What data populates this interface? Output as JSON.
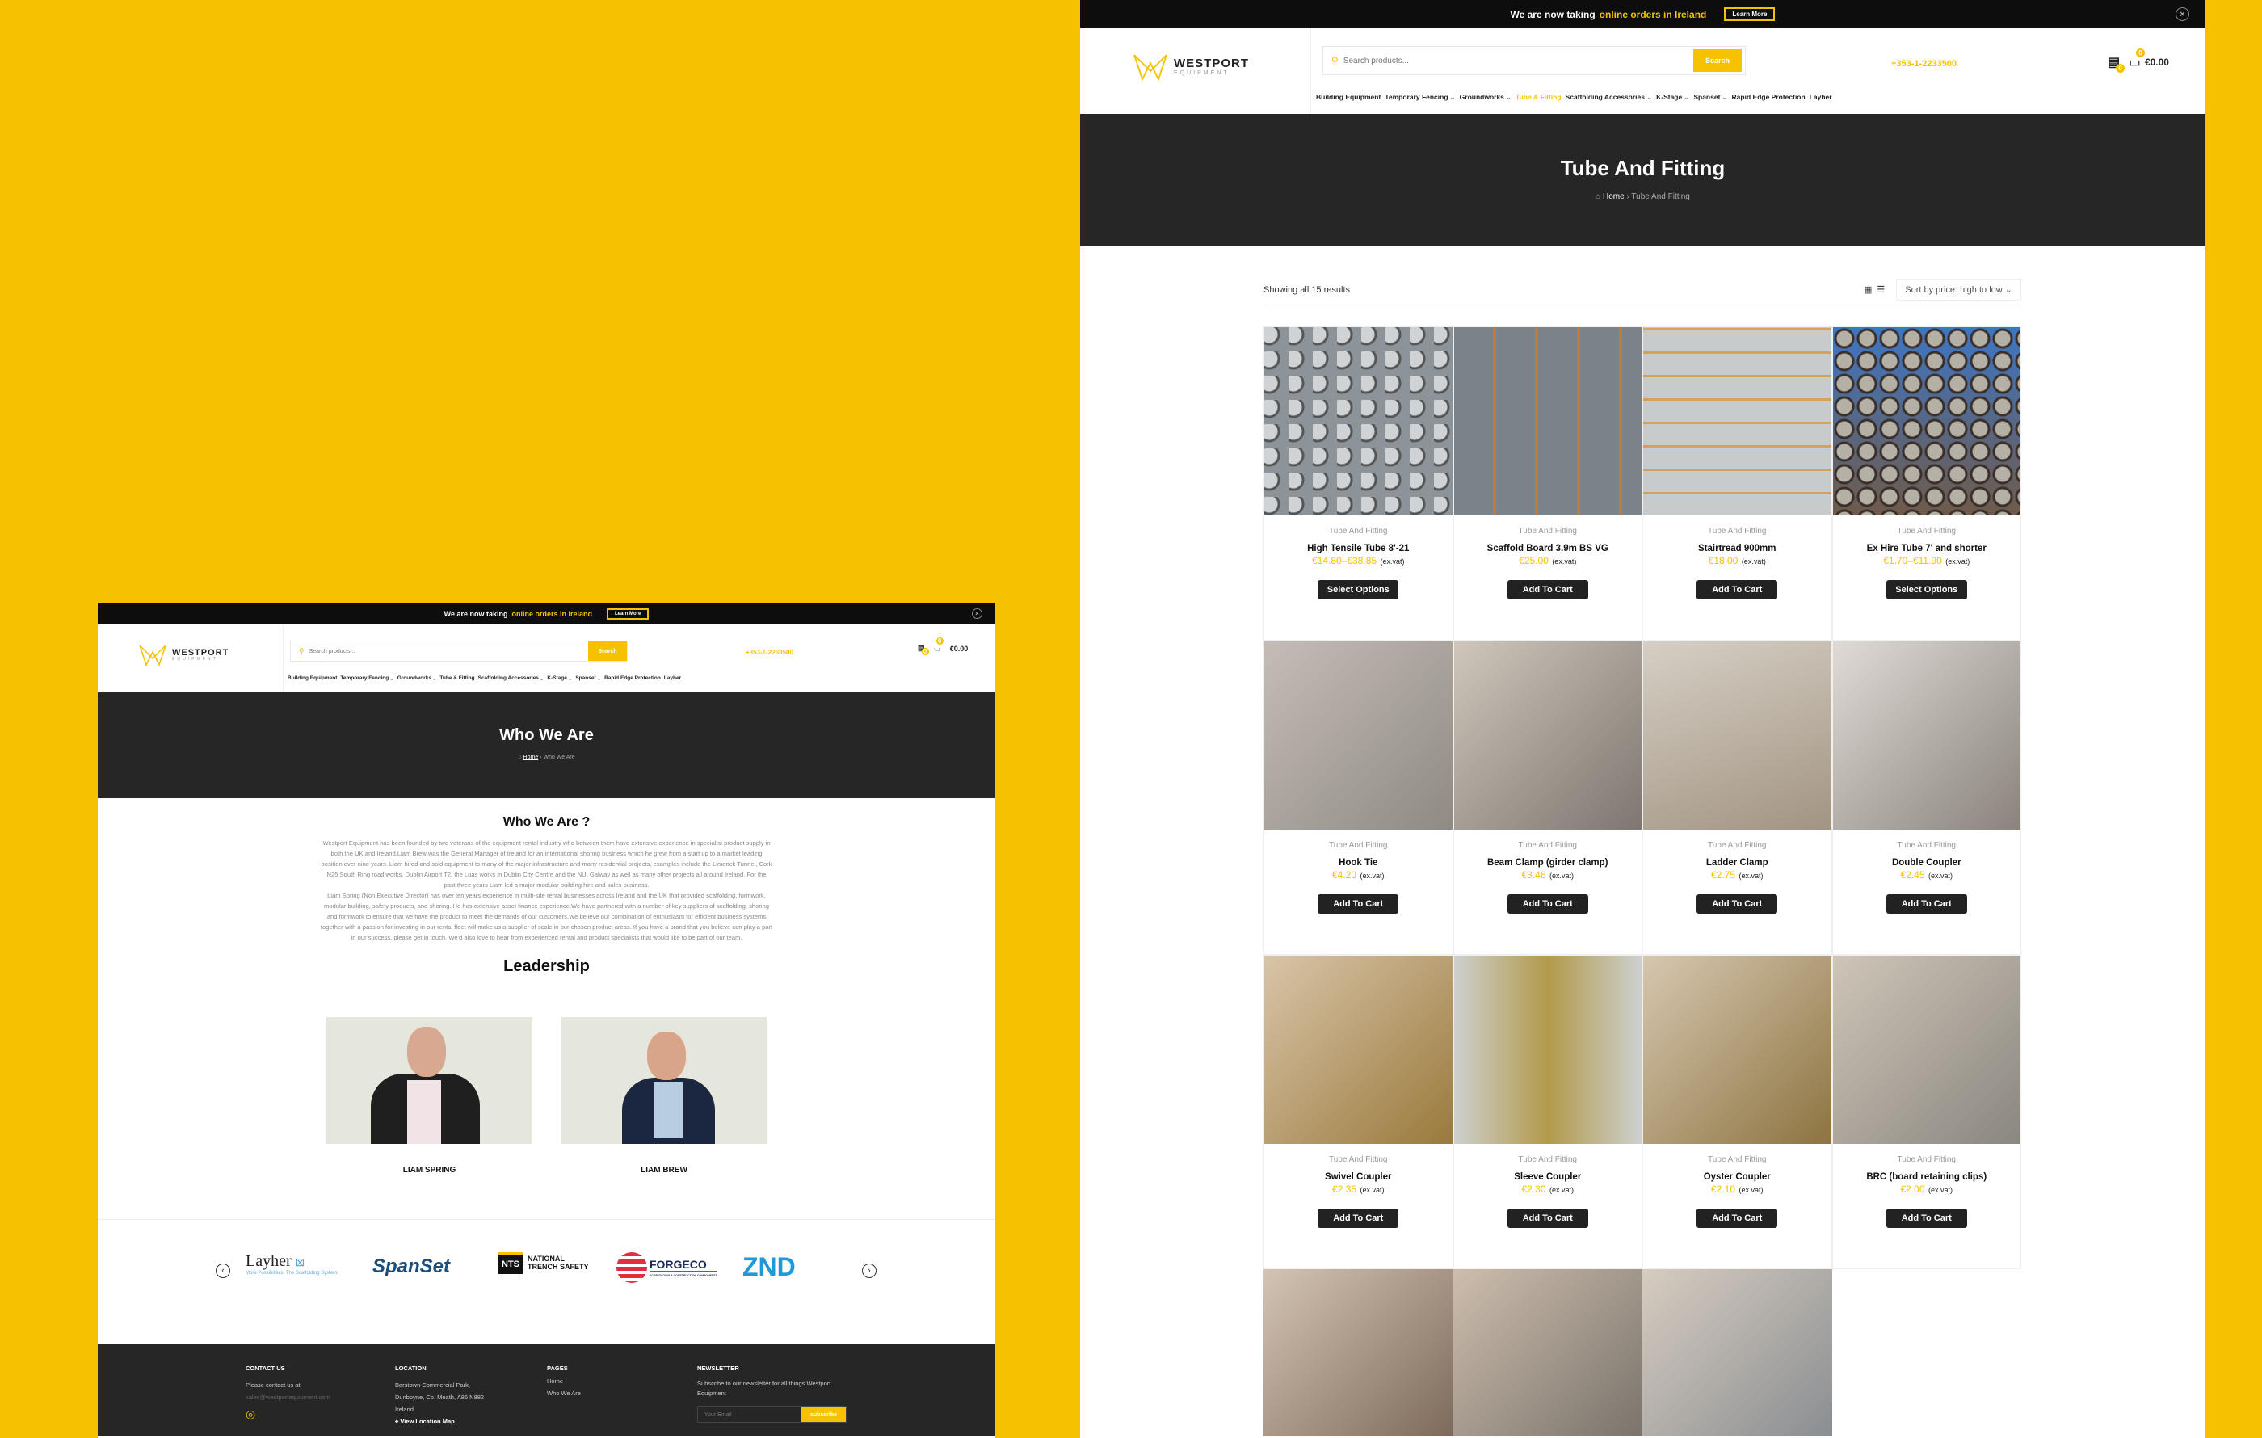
{
  "colors": {
    "brand_yellow": "#f6c200",
    "dark": "#262626",
    "topbar": "#0d0d0d"
  },
  "announcement": {
    "prefix": "We are now taking",
    "highlight": "online orders in Ireland",
    "learn_more": "Learn More",
    "close_icon": "close-circle-icon"
  },
  "brand": {
    "name": "WESTPORT",
    "sub": "EQUIPMENT"
  },
  "search": {
    "placeholder": "Search products...",
    "button": "Search"
  },
  "phone": "+353-1-2233500",
  "wishlist_count": "0",
  "cart": {
    "count": "0",
    "total": "€0.00"
  },
  "nav": [
    "Building Equipment",
    "Temporary Fencing",
    "Groundworks",
    "Tube & Fitting",
    "Scaffolding Accessories",
    "K-Stage",
    "Spanset",
    "Rapid Edge Protection",
    "Layher"
  ],
  "nav_dropdowns": [
    false,
    true,
    true,
    false,
    true,
    true,
    true,
    false,
    false
  ],
  "left_page": {
    "title": "Who We Are",
    "breadcrumb": {
      "home": "Home",
      "current": "Who We Are"
    },
    "section_title": "Who We Are ?",
    "paragraphs": [
      "Westport Equipment has been founded by two veterans of the equipment rental industry who between them have extensive experience in specialist product supply in both the UK and Ireland.Liam Brew was the General Manager of Ireland for an international shoring business which he grew from a start up to a market leading position over nine years. Liam hired and sold equipment to many of the major infrastructure and many residential projects, examples include the Limerick Tunnel, Cork N25 South Ring road works, Dublin Airport T2, the Luas works in Dublin City Centre and the NUI Galway as well as many other projects all around Ireland. For the past three years Liam led a major modular building hire and sales business.",
      "Liam Spring (Non Executive Director) has over ten years experience in multi-site rental businesses across Ireland and the UK that provided scaffolding, formwork, modular building, safety products, and shoring. He has extensive asset finance experience.We have partnered with a number of key suppliers of scaffolding, shoring and formwork to ensure that we have the product to meet the demands of our customers.We believe our combination of enthusiasm for efficient business systems together with a passion for investing in our rental fleet will make us a supplier of scale in our chosen product areas. If you have a brand that you believe can play a part in our success, please get in touch. We'd also love to hear from experienced rental and product specialists that would like to be part of our team."
    ],
    "leadership_title": "Leadership",
    "leaders": [
      {
        "name": "LIAM SPRING"
      },
      {
        "name": "LIAM BREW"
      }
    ],
    "partner_logos": [
      "Layher",
      "SpanSet",
      "NATIONAL TRENCH SAFETY",
      "FORGECO",
      "ZND"
    ],
    "partner_taglines": {
      "layher": "More Possibilities. The Scaffolding System.",
      "nts": "NTS",
      "forgeco": "SCAFFOLDING & CONSTRUCTION COMPONENTS"
    },
    "footer": {
      "contact": {
        "title": "CONTACT US",
        "text": "Please contact us at",
        "email": "sales@westportequipment.com"
      },
      "location": {
        "title": "LOCATION",
        "lines": [
          "Barstown Commercial Park,",
          "Dunboyne, Co. Meath, A86 N882",
          "Ireland."
        ],
        "map_link": "View Location Map"
      },
      "pages": {
        "title": "PAGES",
        "links": [
          "Home",
          "Who We Are"
        ]
      },
      "newsletter": {
        "title": "NEWSLETTER",
        "text": "Subscribe to our newsletter for all things Westport Equipment",
        "placeholder": "Your Email",
        "button": "subscribe"
      }
    }
  },
  "right_page": {
    "title": "Tube And Fitting",
    "breadcrumb": {
      "home": "Home",
      "current": "Tube And Fitting"
    },
    "results": "Showing all 15 results",
    "sort": "Sort by price: high to low",
    "ex_vat": "(ex.vat)",
    "products": [
      {
        "category": "Tube And Fitting",
        "name": "High Tensile Tube 8'-21",
        "price": "€14.80–€38.85",
        "button": "Select Options"
      },
      {
        "category": "Tube And Fitting",
        "name": "Scaffold Board 3.9m BS VG",
        "price": "€25.00",
        "button": "Add To Cart"
      },
      {
        "category": "Tube And Fitting",
        "name": "Stairtread 900mm",
        "price": "€18.00",
        "button": "Add To Cart"
      },
      {
        "category": "Tube And Fitting",
        "name": "Ex Hire Tube 7' and shorter",
        "price": "€1.70–€11.90",
        "button": "Select Options"
      },
      {
        "category": "Tube And Fitting",
        "name": "Hook Tie",
        "price": "€4.20",
        "button": "Add To Cart"
      },
      {
        "category": "Tube And Fitting",
        "name": "Beam Clamp (girder clamp)",
        "price": "€3.46",
        "button": "Add To Cart"
      },
      {
        "category": "Tube And Fitting",
        "name": "Ladder Clamp",
        "price": "€2.75",
        "button": "Add To Cart"
      },
      {
        "category": "Tube And Fitting",
        "name": "Double Coupler",
        "price": "€2.45",
        "button": "Add To Cart"
      },
      {
        "category": "Tube And Fitting",
        "name": "Swivel Coupler",
        "price": "€2.35",
        "button": "Add To Cart"
      },
      {
        "category": "Tube And Fitting",
        "name": "Sleeve Coupler",
        "price": "€2.30",
        "button": "Add To Cart"
      },
      {
        "category": "Tube And Fitting",
        "name": "Oyster Coupler",
        "price": "€2.10",
        "button": "Add To Cart"
      },
      {
        "category": "Tube And Fitting",
        "name": "BRC (board retaining clips)",
        "price": "€2.00",
        "button": "Add To Cart"
      },
      {
        "category": "",
        "name": "",
        "price": "",
        "button": ""
      },
      {
        "category": "",
        "name": "",
        "price": "",
        "button": ""
      },
      {
        "category": "",
        "name": "",
        "price": "",
        "button": ""
      }
    ]
  }
}
